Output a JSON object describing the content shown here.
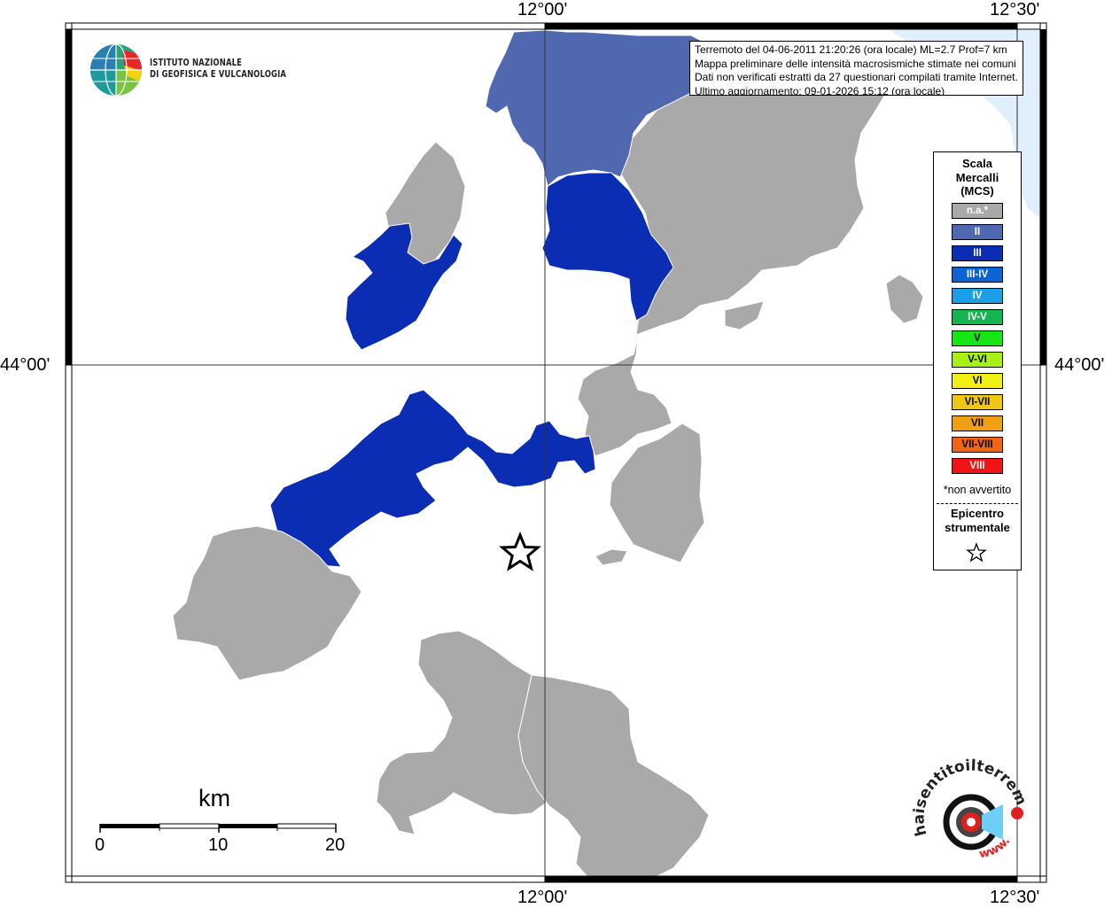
{
  "map": {
    "coordinates": {
      "top": [
        "12°00'",
        "12°30'"
      ],
      "bottom": [
        "12°00'",
        "12°30'"
      ],
      "left": "44°00'",
      "right": "44°00'"
    },
    "epicenter_icon": "star-icon"
  },
  "institute": {
    "line1": "ISTITUTO NAZIONALE",
    "line2": "DI GEOFISICA E VULCANOLOGIA"
  },
  "info": {
    "line1": "Terremoto del 04-06-2011 21:20:26 (ora locale) ML=2.7 Prof=7 km",
    "line2": "Mappa preliminare delle intensità macrosismiche stimate nei comuni",
    "line3": "Dati non verificati estratti da 27 questionari compilati tramite Internet.",
    "line4": "Ultimo aggiornamento: 09-01-2026 15:12 (ora locale)"
  },
  "legend": {
    "title1": "Scala",
    "title2": "Mercalli",
    "title3": "(MCS)",
    "items": [
      {
        "label": "n.a.*",
        "color": "#a9a9a9",
        "text": "#ffffff"
      },
      {
        "label": "II",
        "color": "#5068b0",
        "text": "#ffffff"
      },
      {
        "label": "III",
        "color": "#0a2db4",
        "text": "#ffffff"
      },
      {
        "label": "III-IV",
        "color": "#0a64d2",
        "text": "#ffffff"
      },
      {
        "label": "IV",
        "color": "#1aa0e6",
        "text": "#ffffff"
      },
      {
        "label": "IV-V",
        "color": "#14b450",
        "text": "#ffffff"
      },
      {
        "label": "V",
        "color": "#14e614",
        "text": "#000000"
      },
      {
        "label": "V-VI",
        "color": "#aaf014",
        "text": "#000000"
      },
      {
        "label": "VI",
        "color": "#f0f014",
        "text": "#000000"
      },
      {
        "label": "VI-VII",
        "color": "#f0c814",
        "text": "#000000"
      },
      {
        "label": "VII",
        "color": "#f0a014",
        "text": "#000000"
      },
      {
        "label": "VII-VIII",
        "color": "#f06414",
        "text": "#000000"
      },
      {
        "label": "VIII",
        "color": "#f01414",
        "text": "#ffffff"
      }
    ],
    "note": "*non avvertito",
    "epicenter1": "Epicentro",
    "epicenter2": "strumentale"
  },
  "scale_bar": {
    "unit": "km",
    "ticks": [
      "0",
      "10",
      "20"
    ]
  },
  "watermark": {
    "text_top": "haisentitoilterremoto.it",
    "text_bottom": "www."
  },
  "colors": {
    "na": "#a9a9a9",
    "ii": "#5068b0",
    "iii": "#0a2db4",
    "sea": "#dfeffb"
  }
}
